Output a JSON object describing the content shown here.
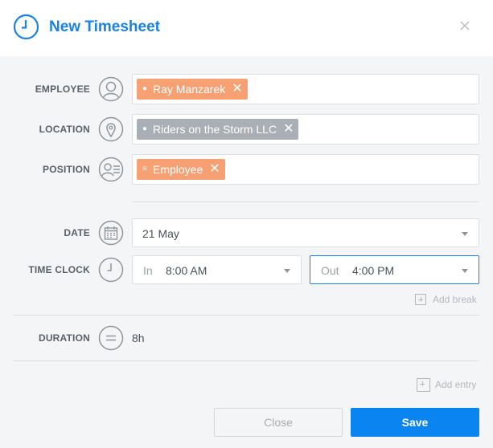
{
  "header": {
    "title": "New Timesheet"
  },
  "form": {
    "employee": {
      "label": "EMPLOYEE",
      "tag": "Ray Manzarek",
      "tag_color": "#f7a073"
    },
    "location": {
      "label": "LOCATION",
      "tag": "Riders on the Storm LLC",
      "tag_color": "#a9afb5"
    },
    "position": {
      "label": "POSITION",
      "tag": "Employee",
      "tag_color": "#f7a073"
    },
    "date": {
      "label": "DATE",
      "value": "21 May"
    },
    "time_clock": {
      "label": "TIME CLOCK",
      "in_prefix": "In",
      "in_value": "8:00 AM",
      "out_prefix": "Out",
      "out_value": "4:00 PM",
      "add_break": "Add break"
    },
    "duration": {
      "label": "DURATION",
      "value": "8h"
    },
    "add_entry": "Add entry"
  },
  "buttons": {
    "close": "Close",
    "save": "Save"
  },
  "colors": {
    "accent": "#1a82e3",
    "primary_button": "#0a84f0",
    "focus_border": "#1a82e3"
  }
}
